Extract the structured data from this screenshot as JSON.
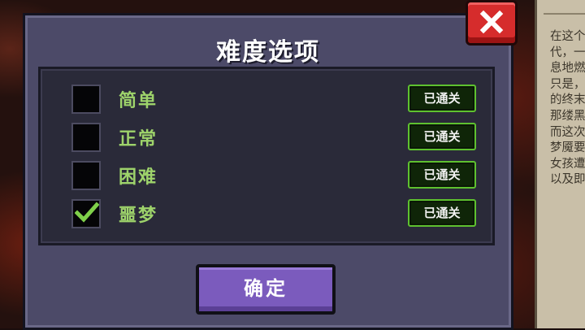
{
  "background": {
    "side_text": "在这个\n代，一\n息地燃\n只是，\n的终末\n那缕黑\n而这次\n梦魇要\n女孩遭\n以及即"
  },
  "dialog": {
    "title": "难度选项",
    "options": [
      {
        "label": "简单",
        "checked": false,
        "status": "已通关"
      },
      {
        "label": "正常",
        "checked": false,
        "status": "已通关"
      },
      {
        "label": "困难",
        "checked": false,
        "status": "已通关"
      },
      {
        "label": "噩梦",
        "checked": true,
        "status": "已通关"
      }
    ],
    "confirm_label": "确定",
    "close_icon": "close-icon"
  },
  "colors": {
    "dialog_bg": "#4c4a68",
    "label_green": "#9ed36b",
    "badge_border": "#5ec12f",
    "confirm_purple": "#7b5bbd",
    "close_red": "#d62c2c"
  }
}
